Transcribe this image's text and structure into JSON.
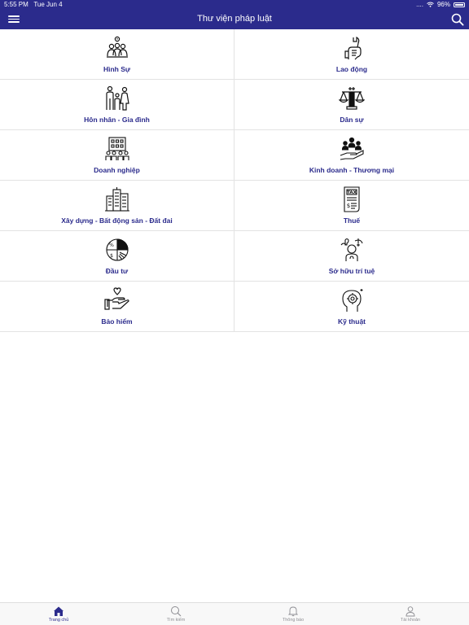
{
  "status_bar": {
    "time": "5:55 PM",
    "date": "Tue Jun 4",
    "signal": "....",
    "battery": "96%"
  },
  "header": {
    "title": "Thư viện pháp luật",
    "menu_icon": "hamburger-menu-icon",
    "search_icon": "search-icon"
  },
  "categories": [
    {
      "label": "Hình Sự",
      "icon": "criminal-people-icon"
    },
    {
      "label": "Lao động",
      "icon": "labor-wrench-hand-icon"
    },
    {
      "label": "Hôn nhân - Gia đình",
      "icon": "family-icon"
    },
    {
      "label": "Dân sự",
      "icon": "justice-scales-icon"
    },
    {
      "label": "Doanh nghiệp",
      "icon": "enterprise-building-icon"
    },
    {
      "label": "Kinh doanh - Thương mại",
      "icon": "business-hand-people-icon"
    },
    {
      "label": "Xây dựng - Bất động sản - Đất đai",
      "icon": "construction-buildings-icon"
    },
    {
      "label": "Thuế",
      "icon": "tax-document-icon"
    },
    {
      "label": "Đầu tư",
      "icon": "investment-pie-icon"
    },
    {
      "label": "Sở hữu trí tuệ",
      "icon": "intellectual-property-icon"
    },
    {
      "label": "Bảo hiểm",
      "icon": "insurance-hand-heart-icon"
    },
    {
      "label": "Kỹ thuật",
      "icon": "technology-head-gear-icon"
    }
  ],
  "tab_bar": {
    "tabs": [
      {
        "label": "Trang chủ",
        "icon": "home-icon",
        "active": true
      },
      {
        "label": "Tìm kiếm",
        "icon": "search-icon",
        "active": false
      },
      {
        "label": "Thông báo",
        "icon": "bell-icon",
        "active": false
      },
      {
        "label": "Tài khoản",
        "icon": "user-icon",
        "active": false
      }
    ]
  },
  "colors": {
    "primary": "#2b2b8c",
    "inactive": "#8e8e93",
    "divider": "#e3e3e3"
  }
}
